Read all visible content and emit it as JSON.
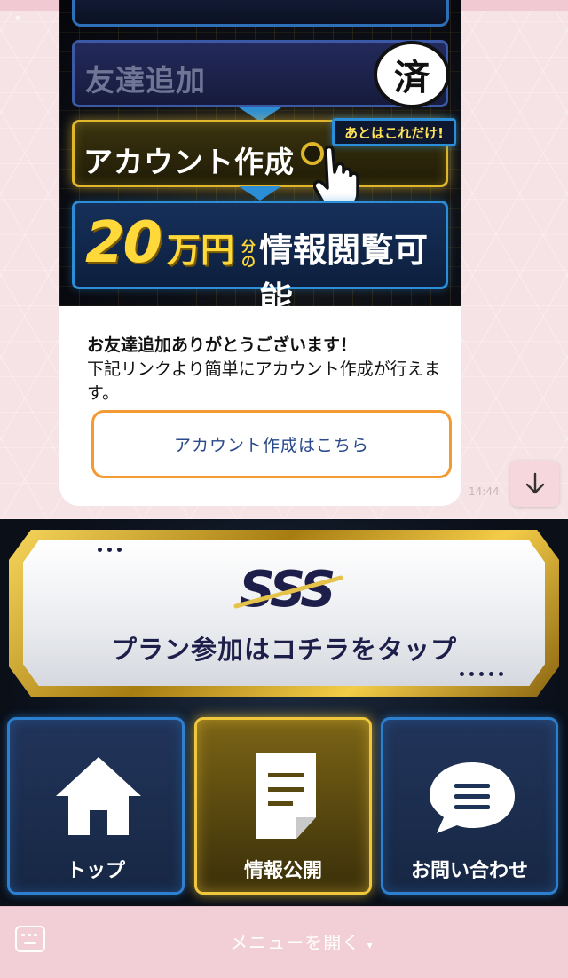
{
  "chat": {
    "banner": {
      "step1_label": "友達追加",
      "done_badge": "済",
      "step2_label": "アカウント作成",
      "callout": "あとはこれだけ!",
      "step3_number": "20",
      "step3_unit": "万円",
      "step3_no": "分の",
      "step3_text": "情報閲覧可能"
    },
    "message_line1": "お友達追加ありがとうございます！",
    "message_line2": "下記リンクより簡単にアカウント作成が行えます。",
    "link_label": "アカウント作成はこちら",
    "timestamp": "14:44"
  },
  "rich_menu": {
    "plan_logo": "SSS",
    "plan_cta": "プラン参加はコチラをタップ",
    "tiles": [
      {
        "label": "トップ",
        "icon": "home-icon"
      },
      {
        "label": "情報公開",
        "icon": "document-icon"
      },
      {
        "label": "お問い合わせ",
        "icon": "chat-bubble-icon"
      }
    ]
  },
  "bottom_bar": {
    "menu_toggle_label": "メニューを開く",
    "menu_toggle_caret": "▾"
  },
  "colors": {
    "accent_gold": "#f0c63c",
    "accent_blue": "#2d7fd0",
    "link_border": "#f39a33",
    "bottom_bar": "#f2cfd6"
  }
}
